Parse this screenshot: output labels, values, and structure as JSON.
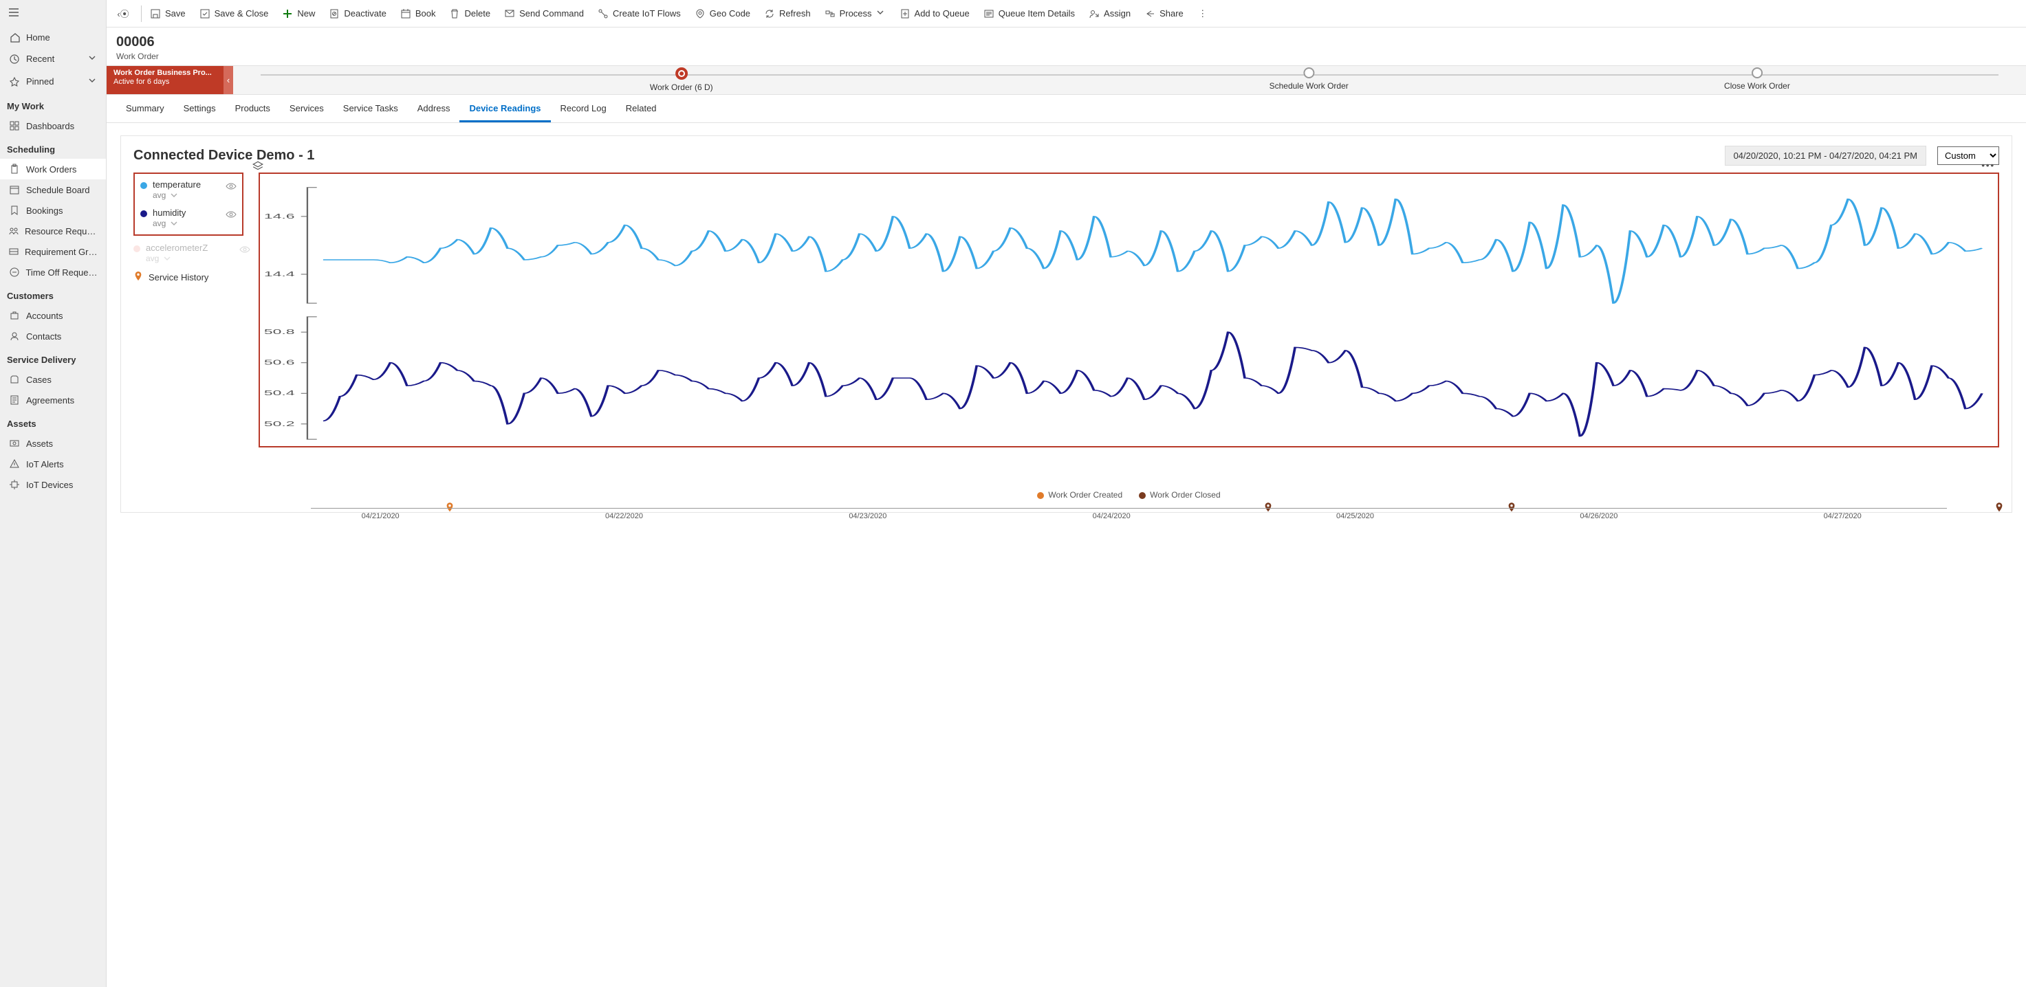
{
  "sidebar": {
    "top": [
      {
        "label": "Home",
        "icon": "home",
        "chev": false
      },
      {
        "label": "Recent",
        "icon": "clock",
        "chev": true
      },
      {
        "label": "Pinned",
        "icon": "pin",
        "chev": true
      }
    ],
    "groups": [
      {
        "title": "My Work",
        "items": [
          {
            "label": "Dashboards",
            "icon": "dashboard"
          }
        ]
      },
      {
        "title": "Scheduling",
        "items": [
          {
            "label": "Work Orders",
            "icon": "clipboard",
            "active": true
          },
          {
            "label": "Schedule Board",
            "icon": "calendar"
          },
          {
            "label": "Bookings",
            "icon": "booking"
          },
          {
            "label": "Resource Requireme...",
            "icon": "resreq"
          },
          {
            "label": "Requirement Groups",
            "icon": "reqgroup"
          },
          {
            "label": "Time Off Requests",
            "icon": "timeoff"
          }
        ]
      },
      {
        "title": "Customers",
        "items": [
          {
            "label": "Accounts",
            "icon": "account"
          },
          {
            "label": "Contacts",
            "icon": "contact"
          }
        ]
      },
      {
        "title": "Service Delivery",
        "items": [
          {
            "label": "Cases",
            "icon": "case"
          },
          {
            "label": "Agreements",
            "icon": "agreement"
          }
        ]
      },
      {
        "title": "Assets",
        "items": [
          {
            "label": "Assets",
            "icon": "asset"
          },
          {
            "label": "IoT Alerts",
            "icon": "iotalert"
          },
          {
            "label": "IoT Devices",
            "icon": "iotdev"
          }
        ]
      }
    ]
  },
  "commandbar": [
    {
      "kind": "back",
      "label": ""
    },
    {
      "kind": "sep"
    },
    {
      "label": "Save",
      "icon": "save"
    },
    {
      "label": "Save & Close",
      "icon": "saveclose"
    },
    {
      "label": "New",
      "icon": "new",
      "color": "#107c10"
    },
    {
      "label": "Deactivate",
      "icon": "deactivate"
    },
    {
      "label": "Book",
      "icon": "book"
    },
    {
      "label": "Delete",
      "icon": "delete"
    },
    {
      "label": "Send Command",
      "icon": "send"
    },
    {
      "label": "Create IoT Flows",
      "icon": "flow"
    },
    {
      "label": "Geo Code",
      "icon": "geo"
    },
    {
      "label": "Refresh",
      "icon": "refresh"
    },
    {
      "label": "Process",
      "icon": "process",
      "chev": true
    },
    {
      "label": "Add to Queue",
      "icon": "queueadd"
    },
    {
      "label": "Queue Item Details",
      "icon": "queuedet"
    },
    {
      "label": "Assign",
      "icon": "assign"
    },
    {
      "label": "Share",
      "icon": "share"
    },
    {
      "kind": "overflow"
    }
  ],
  "header": {
    "num": "00006",
    "entity": "Work Order"
  },
  "bpf": {
    "name": "Work Order Business Pro...",
    "sub": "Active for 6 days",
    "stages": [
      {
        "label": "Work Order",
        "suffix": "(6 D)",
        "current": true,
        "pos": 25
      },
      {
        "label": "Schedule Work Order",
        "pos": 60
      },
      {
        "label": "Close Work Order",
        "pos": 85
      }
    ]
  },
  "tabs": [
    "Summary",
    "Settings",
    "Products",
    "Services",
    "Service Tasks",
    "Address",
    "Device Readings",
    "Record Log",
    "Related"
  ],
  "activeTab": "Device Readings",
  "panel": {
    "title": "Connected Device Demo - 1",
    "dateRange": "04/20/2020, 10:21 PM - 04/27/2020, 04:21 PM",
    "rangeMode": "Custom",
    "seriesLegend": [
      {
        "name": "temperature",
        "agg": "avg",
        "color": "#3aa7e6",
        "active": true
      },
      {
        "name": "humidity",
        "agg": "avg",
        "color": "#1a1a8a",
        "active": true
      },
      {
        "name": "accelerometerZ",
        "agg": "avg",
        "color": "#f4b9b3",
        "active": false
      }
    ],
    "serviceHistoryLabel": "Service History",
    "footerLegend": [
      {
        "label": "Work Order Created",
        "color": "#e07b2a"
      },
      {
        "label": "Work Order Closed",
        "color": "#7a3b1f"
      }
    ],
    "xTicks": [
      {
        "label": "04/21/2020",
        "pos": 4
      },
      {
        "label": "04/22/2020",
        "pos": 18
      },
      {
        "label": "04/23/2020",
        "pos": 32
      },
      {
        "label": "04/24/2020",
        "pos": 46
      },
      {
        "label": "04/25/2020",
        "pos": 60
      },
      {
        "label": "04/26/2020",
        "pos": 74
      },
      {
        "label": "04/27/2020",
        "pos": 88
      }
    ],
    "pins": [
      {
        "pos": 8,
        "color": "#e07b2a"
      },
      {
        "pos": 55,
        "color": "#7a3b1f"
      },
      {
        "pos": 69,
        "color": "#7a3b1f"
      },
      {
        "pos": 97,
        "color": "#7a3b1f"
      }
    ]
  },
  "chart_data": [
    {
      "type": "line",
      "title": "temperature (avg)",
      "xlabel": "",
      "ylabel": "",
      "ylim": [
        14.3,
        14.7
      ],
      "yticks": [
        14.4,
        14.6
      ],
      "x_range": [
        "2020-04-20T22:21",
        "2020-04-27T16:21"
      ],
      "color": "#3aa7e6",
      "note": "Values read approximately from the chart; x is index 0-99 evenly over x_range.",
      "values": [
        14.45,
        14.45,
        14.45,
        14.45,
        14.44,
        14.46,
        14.44,
        14.49,
        14.52,
        14.47,
        14.56,
        14.49,
        14.45,
        14.46,
        14.5,
        14.51,
        14.47,
        14.51,
        14.57,
        14.49,
        14.45,
        14.43,
        14.48,
        14.55,
        14.48,
        14.52,
        14.44,
        14.54,
        14.48,
        14.53,
        14.41,
        14.45,
        14.54,
        14.48,
        14.6,
        14.49,
        14.54,
        14.41,
        14.53,
        14.42,
        14.48,
        14.56,
        14.49,
        14.42,
        14.55,
        14.45,
        14.6,
        14.46,
        14.48,
        14.43,
        14.55,
        14.41,
        14.48,
        14.55,
        14.41,
        14.5,
        14.53,
        14.49,
        14.55,
        14.5,
        14.65,
        14.51,
        14.63,
        14.5,
        14.66,
        14.47,
        14.49,
        14.51,
        14.44,
        14.45,
        14.52,
        14.41,
        14.58,
        14.42,
        14.64,
        14.46,
        14.5,
        14.3,
        14.55,
        14.46,
        14.57,
        14.46,
        14.6,
        14.5,
        14.59,
        14.47,
        14.49,
        14.5,
        14.42,
        14.44,
        14.57,
        14.66,
        14.5,
        14.63,
        14.49,
        14.54,
        14.47,
        14.51,
        14.48,
        14.49
      ]
    },
    {
      "type": "line",
      "title": "humidity (avg)",
      "xlabel": "",
      "ylabel": "",
      "ylim": [
        50.1,
        50.9
      ],
      "yticks": [
        50.2,
        50.4,
        50.6,
        50.8
      ],
      "x_range": [
        "2020-04-20T22:21",
        "2020-04-27T16:21"
      ],
      "color": "#1a1a8a",
      "note": "Values read approximately from the chart; x is index 0-99 evenly over x_range.",
      "values": [
        50.22,
        50.38,
        50.52,
        50.49,
        50.6,
        50.45,
        50.48,
        50.6,
        50.55,
        50.48,
        50.45,
        50.2,
        50.4,
        50.5,
        50.4,
        50.43,
        50.25,
        50.45,
        50.4,
        50.45,
        50.55,
        50.52,
        50.48,
        50.43,
        50.4,
        50.35,
        50.5,
        50.6,
        50.45,
        50.6,
        50.38,
        50.45,
        50.5,
        50.36,
        50.5,
        50.5,
        50.36,
        50.4,
        50.3,
        50.58,
        50.5,
        50.6,
        50.4,
        50.48,
        50.4,
        50.55,
        50.42,
        50.38,
        50.5,
        50.36,
        50.45,
        50.4,
        50.3,
        50.55,
        50.8,
        50.5,
        50.45,
        50.4,
        50.7,
        50.68,
        50.6,
        50.68,
        50.44,
        50.4,
        50.35,
        50.4,
        50.45,
        50.48,
        50.4,
        50.38,
        50.3,
        50.25,
        50.4,
        50.35,
        50.4,
        50.12,
        50.6,
        50.45,
        50.55,
        50.38,
        50.43,
        50.42,
        50.55,
        50.45,
        50.4,
        50.32,
        50.4,
        50.42,
        50.35,
        50.52,
        50.55,
        50.44,
        50.7,
        50.45,
        50.6,
        50.36,
        50.58,
        50.5,
        50.3,
        50.4
      ]
    }
  ]
}
